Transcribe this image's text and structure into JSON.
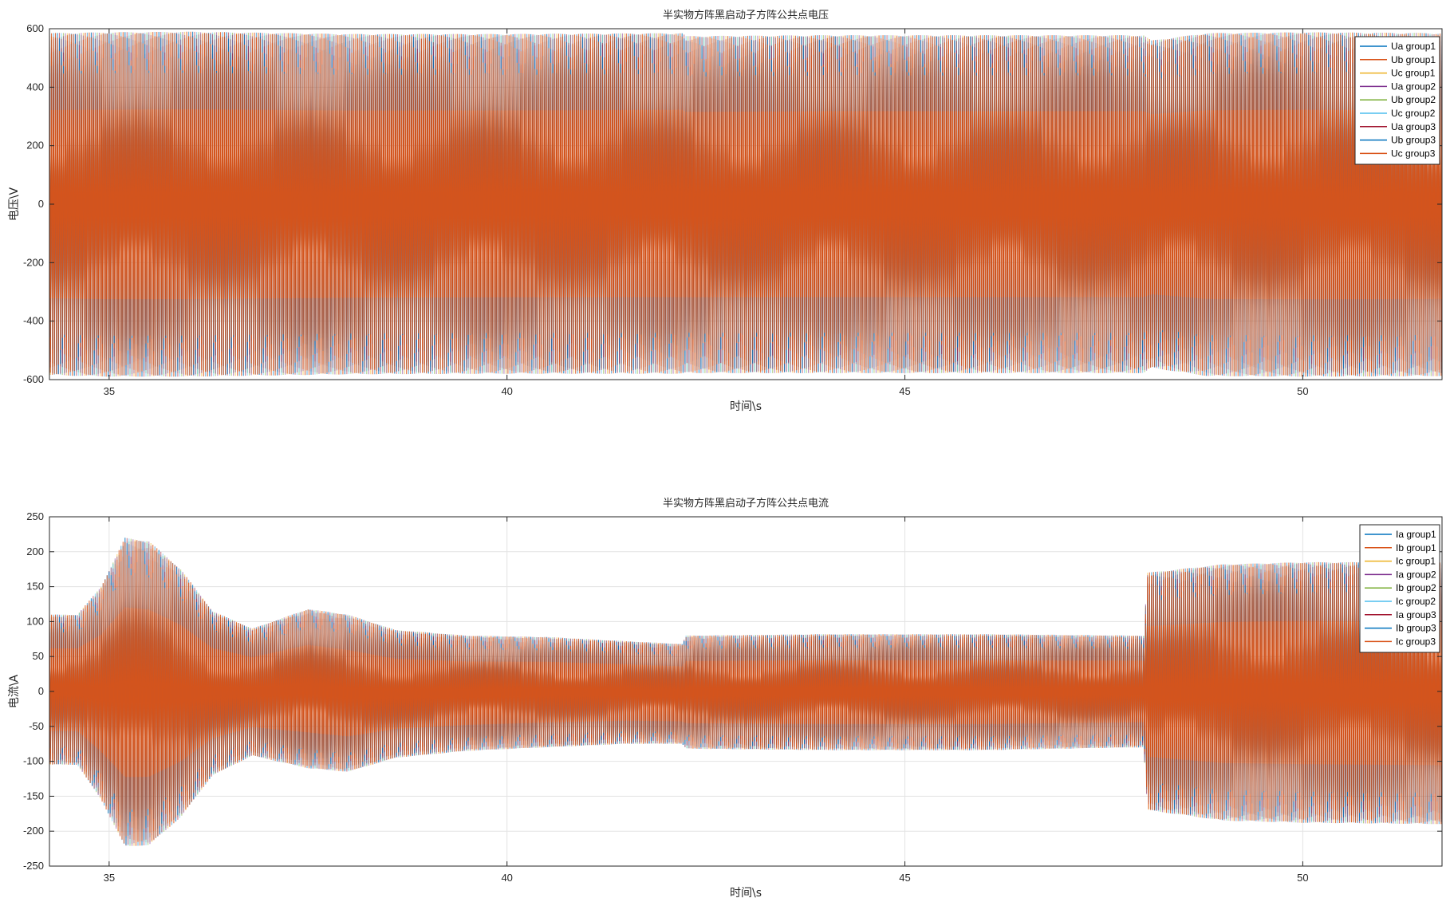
{
  "chart_data": [
    {
      "type": "line",
      "title": "半实物方阵黑启动子方阵公共点电压",
      "xlabel": "时间\\s",
      "ylabel": "电压\\V",
      "xlim": [
        34.25,
        51.75
      ],
      "ylim": [
        -600,
        600
      ],
      "xticks": [
        35,
        40,
        45,
        50
      ],
      "yticks": [
        600,
        400,
        200,
        0,
        -200,
        -400,
        -600
      ],
      "grid": true,
      "legend_position": "top-right",
      "series": [
        {
          "name": "Ua group1",
          "color": "#0072BD"
        },
        {
          "name": "Ub group1",
          "color": "#D95319"
        },
        {
          "name": "Uc group1",
          "color": "#EDB120"
        },
        {
          "name": "Ua group2",
          "color": "#7E2F8E"
        },
        {
          "name": "Ub group2",
          "color": "#77AC30"
        },
        {
          "name": "Uc group2",
          "color": "#4DBEEE"
        },
        {
          "name": "Ua group3",
          "color": "#A2142F"
        },
        {
          "name": "Ub group3",
          "color": "#0072BD"
        },
        {
          "name": "Uc group3",
          "color": "#D95319"
        }
      ],
      "envelope": {
        "x": [
          34.25,
          35.0,
          36.0,
          38.0,
          40.0,
          42.2,
          42.25,
          44.0,
          46.0,
          48.0,
          48.1,
          48.8,
          50.0,
          51.75
        ],
        "upper": [
          585,
          588,
          590,
          582,
          582,
          585,
          575,
          578,
          578,
          578,
          560,
          585,
          588,
          585
        ],
        "lower": [
          -585,
          -590,
          -590,
          -582,
          -580,
          -580,
          -578,
          -578,
          -578,
          -578,
          -560,
          -588,
          -590,
          -588
        ]
      }
    },
    {
      "type": "line",
      "title": "半实物方阵黑启动子方阵公共点电流",
      "xlabel": "时间\\s",
      "ylabel": "电流\\A",
      "xlim": [
        34.25,
        51.75
      ],
      "ylim": [
        -250,
        250
      ],
      "xticks": [
        35,
        40,
        45,
        50
      ],
      "yticks": [
        250,
        200,
        150,
        100,
        50,
        0,
        -50,
        -100,
        -150,
        -200,
        -250
      ],
      "grid": true,
      "legend_position": "top-right",
      "series": [
        {
          "name": "Ia group1",
          "color": "#0072BD"
        },
        {
          "name": "Ib group1",
          "color": "#D95319"
        },
        {
          "name": "Ic group1",
          "color": "#EDB120"
        },
        {
          "name": "Ia group2",
          "color": "#7E2F8E"
        },
        {
          "name": "Ib group2",
          "color": "#77AC30"
        },
        {
          "name": "Ic group2",
          "color": "#4DBEEE"
        },
        {
          "name": "Ia group3",
          "color": "#A2142F"
        },
        {
          "name": "Ib group3",
          "color": "#0072BD"
        },
        {
          "name": "Ic group3",
          "color": "#D95319"
        }
      ],
      "envelope": {
        "x": [
          34.25,
          34.6,
          34.9,
          35.2,
          35.5,
          35.9,
          36.3,
          36.8,
          37.5,
          38.0,
          38.6,
          39.5,
          40.5,
          41.5,
          42.2,
          42.25,
          44.0,
          46.0,
          48.0,
          48.05,
          49.0,
          50.0,
          51.75
        ],
        "upper": [
          110,
          110,
          150,
          220,
          215,
          175,
          115,
          90,
          118,
          110,
          88,
          80,
          78,
          72,
          68,
          80,
          82,
          82,
          80,
          170,
          182,
          185,
          185
        ],
        "lower": [
          -105,
          -105,
          -155,
          -222,
          -220,
          -180,
          -120,
          -92,
          -110,
          -115,
          -95,
          -85,
          -80,
          -75,
          -75,
          -82,
          -84,
          -84,
          -80,
          -170,
          -185,
          -188,
          -190
        ]
      }
    }
  ]
}
